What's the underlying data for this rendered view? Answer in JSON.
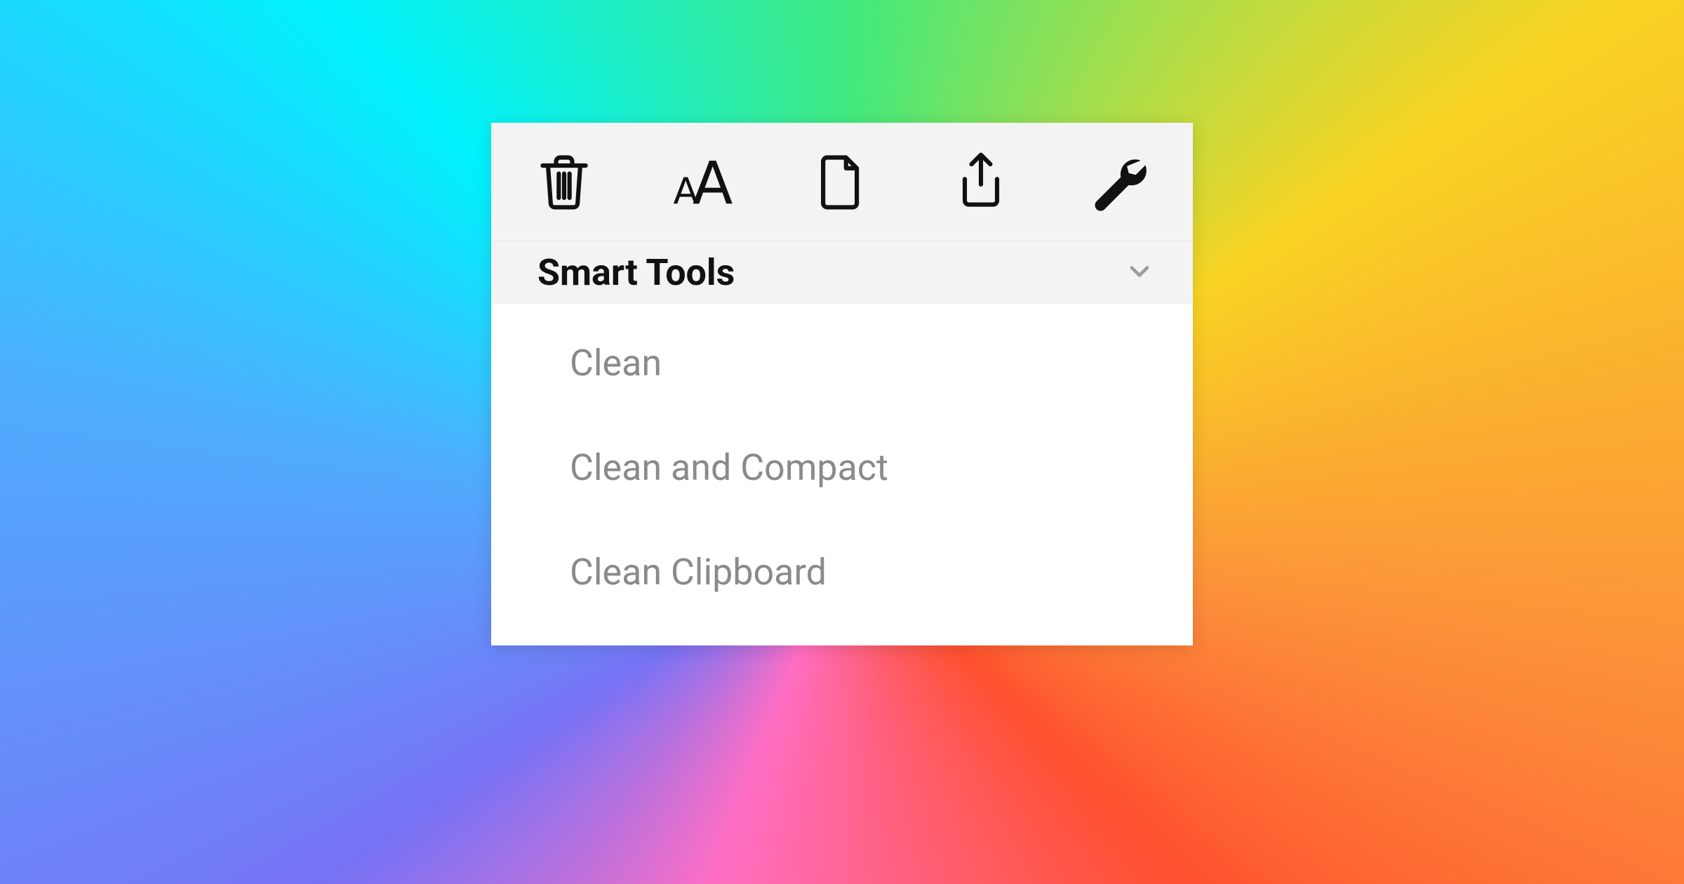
{
  "toolbar": {
    "icons": [
      {
        "name": "trash-icon"
      },
      {
        "name": "text-size-icon"
      },
      {
        "name": "document-icon"
      },
      {
        "name": "share-icon"
      },
      {
        "name": "wrench-icon"
      }
    ]
  },
  "section": {
    "title": "Smart Tools"
  },
  "items": [
    {
      "label": "Clean"
    },
    {
      "label": "Clean and Compact"
    },
    {
      "label": "Clean Clipboard"
    }
  ]
}
